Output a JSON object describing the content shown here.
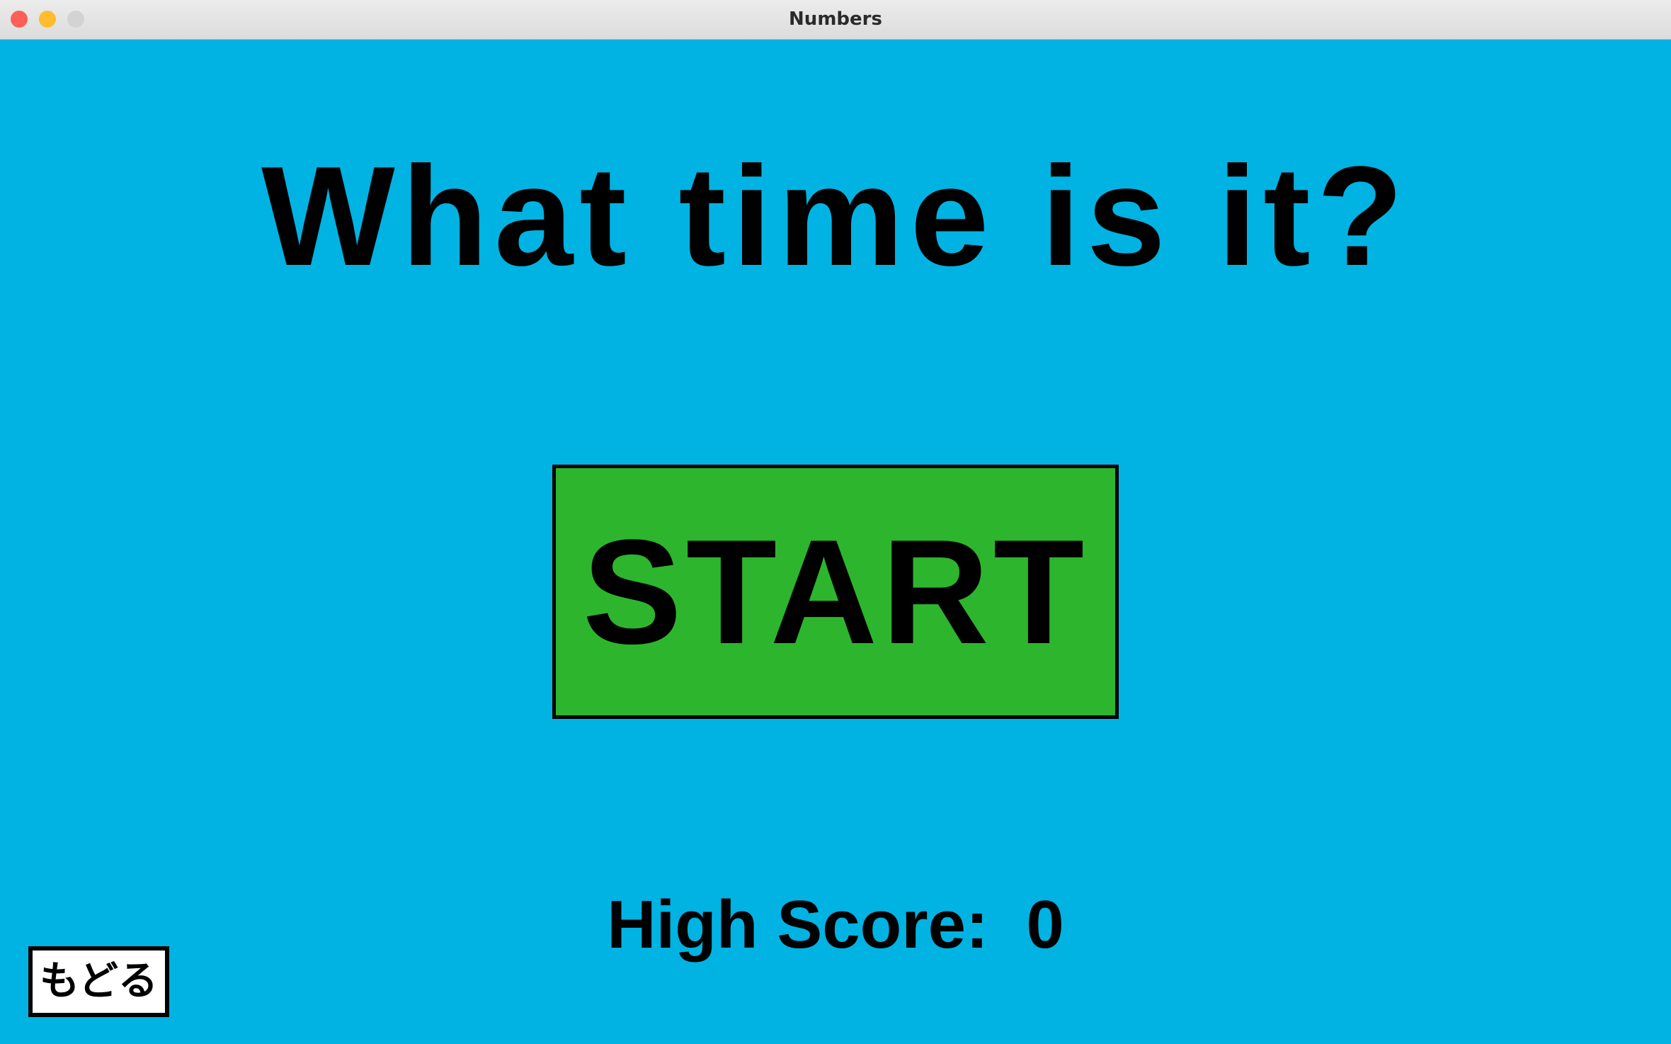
{
  "window": {
    "title": "Numbers",
    "close_color": "#fe5f57",
    "minimize_color": "#febc2e",
    "zoom_color": "#d3d3d3"
  },
  "game": {
    "background": "#00b3e2",
    "title": "What time is it?",
    "start_label": "START",
    "start_color": "#2db52e",
    "high_score_label": "High Score:",
    "high_score_value": 0,
    "back_label": "もどる"
  }
}
